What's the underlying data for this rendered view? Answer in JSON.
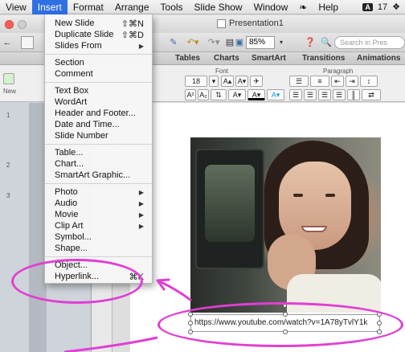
{
  "menubar": {
    "items": [
      "View",
      "Insert",
      "Format",
      "Arrange",
      "Tools",
      "Slide Show",
      "Window",
      "Help"
    ],
    "badge": "17"
  },
  "window": {
    "title": "Presentation1",
    "zoom": "85%",
    "search_placeholder": "Search in Pres"
  },
  "ribbon": {
    "tabs": [
      "Tables",
      "Charts",
      "SmartArt",
      "Transitions",
      "Animations"
    ],
    "font_group": "Font",
    "paragraph_group": "Paragraph",
    "font_size": "18",
    "new_label": "New"
  },
  "sidebar": {
    "slide_numbers": [
      "1",
      "2",
      "3"
    ]
  },
  "insert_menu": {
    "new_slide": "New Slide",
    "new_slide_shortcut": "⇧⌘N",
    "duplicate_slide": "Duplicate Slide",
    "duplicate_slide_shortcut": "⇧⌘D",
    "slides_from": "Slides From",
    "section": "Section",
    "comment": "Comment",
    "text_box": "Text Box",
    "wordart": "WordArt",
    "header_footer": "Header and Footer...",
    "date_time": "Date and Time...",
    "slide_number": "Slide Number",
    "table": "Table...",
    "chart": "Chart...",
    "smartart": "SmartArt Graphic...",
    "photo": "Photo",
    "audio": "Audio",
    "movie": "Movie",
    "clip_art": "Clip Art",
    "symbol": "Symbol...",
    "shape": "Shape...",
    "object": "Object...",
    "hyperlink": "Hyperlink...",
    "hyperlink_shortcut": "⌘K"
  },
  "slide": {
    "link_text": "https://www.youtube.com/watch?v=1A78yTvlY1k"
  },
  "colors": {
    "menu_highlight": "#2f6fe4",
    "annotation": "#e03fd3"
  }
}
